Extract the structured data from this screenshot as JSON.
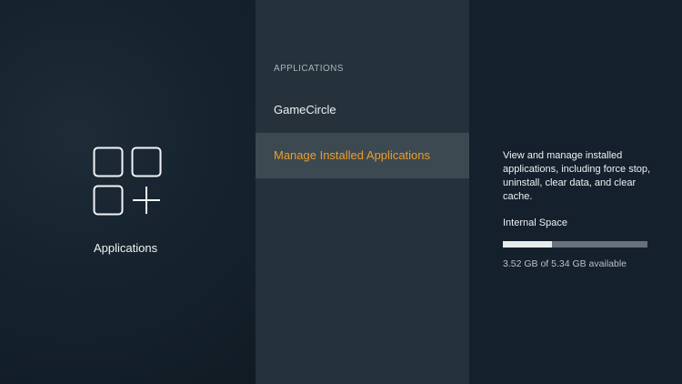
{
  "left_panel": {
    "category_label": "Applications",
    "icon": "applications-grid-icon"
  },
  "middle_panel": {
    "section_header": "APPLICATIONS",
    "items": [
      {
        "label": "GameCircle",
        "selected": false
      },
      {
        "label": "Manage Installed Applications",
        "selected": true
      }
    ]
  },
  "right_panel": {
    "description": "View and manage installed applications, including force stop, uninstall, clear data, and clear cache.",
    "storage": {
      "title": "Internal Space",
      "available_text": "3.52 GB of 5.34 GB available",
      "used_fraction": 0.34
    }
  },
  "colors": {
    "accent": "#e99e2f",
    "background": "#14202b",
    "middle_panel": "#25323c",
    "selected_item": "#3d4951"
  }
}
